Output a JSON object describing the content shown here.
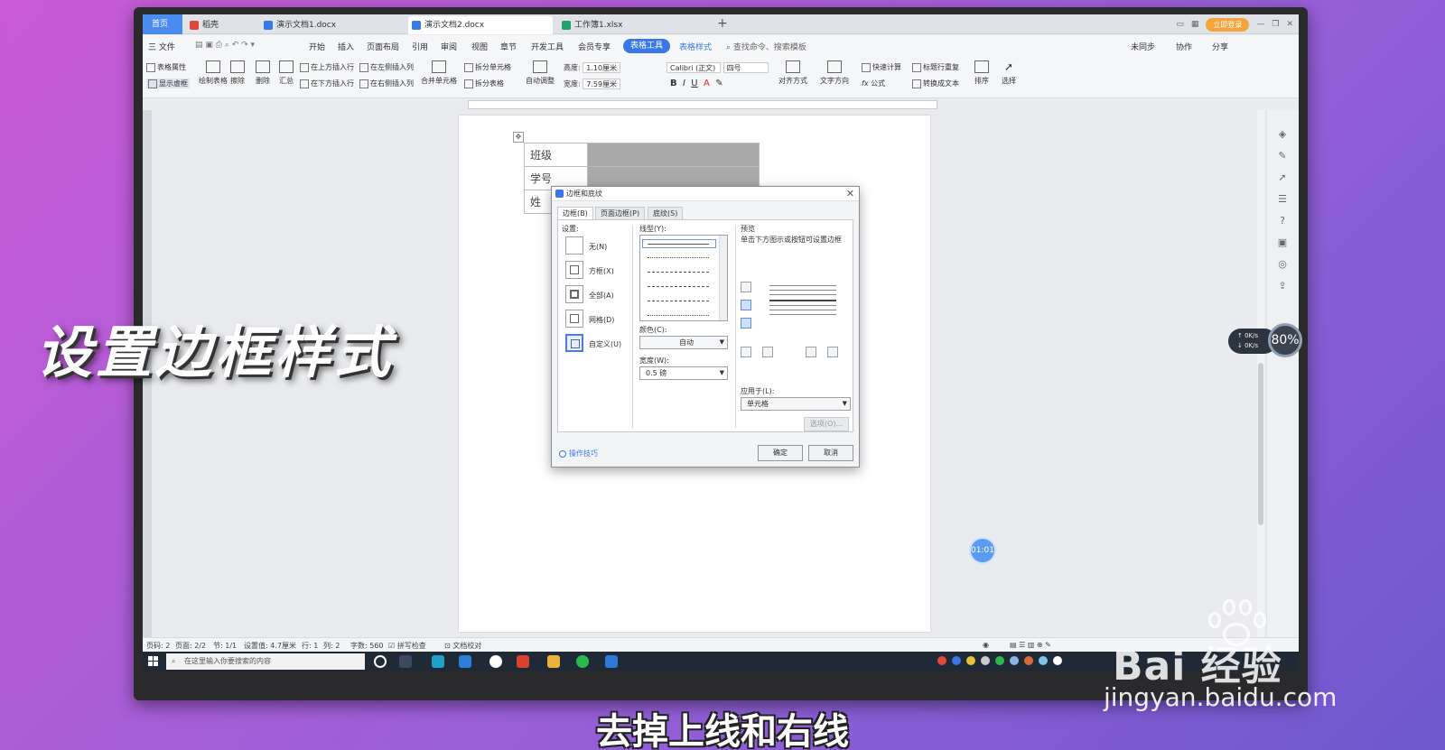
{
  "tabs": {
    "home": "首页",
    "t1": "稻壳",
    "t2": "演示文档1.docx",
    "t3": "演示文档2.docx",
    "t4": "工作簿1.xlsx",
    "plus": "+"
  },
  "topright": {
    "login": "立即登录"
  },
  "menu": {
    "file": "三 文件",
    "items": [
      "开始",
      "插入",
      "页面布局",
      "引用",
      "审阅",
      "视图",
      "章节",
      "开发工具",
      "会员专享"
    ],
    "table_tools": "表格工具",
    "table_style": "表格样式",
    "search": "查找命令、搜索模板",
    "sync": "未同步",
    "collab": "协作",
    "share": "分享"
  },
  "ribbon": {
    "table_props": "表格属性",
    "show_grid": "显示虚框",
    "draw_table": "绘制表格",
    "erase": "擦除",
    "delete": "删除",
    "summary": "汇总",
    "insert_above": "在上方插入行",
    "insert_below": "在下方插入行",
    "insert_left": "在左侧插入列",
    "insert_right": "在右侧插入列",
    "merge": "合并单元格",
    "split_cell": "拆分单元格",
    "split_table": "拆分表格",
    "autofit": "自动调整",
    "height_label": "高度:",
    "height_value": "1.10厘米",
    "width_label": "宽度:",
    "width_value": "7.59厘米",
    "font_name": "Calibri (正文)",
    "font_size": "四号",
    "align": "对齐方式",
    "text_dir": "文字方向",
    "quick_calc": "快速计算",
    "repeat_title": "标题行重复",
    "formula": "公式",
    "to_text": "转换成文本",
    "sort": "排序",
    "select": "选择"
  },
  "doc_table": {
    "rows": [
      "班级",
      "学号",
      "姓"
    ]
  },
  "dialog": {
    "title": "边框和底纹",
    "tabs": [
      "边框(B)",
      "页面边框(P)",
      "底纹(S)"
    ],
    "settings_label": "设置:",
    "settings": [
      "无(N)",
      "方框(X)",
      "全部(A)",
      "网格(D)",
      "自定义(U)"
    ],
    "linetype_label": "线型(Y):",
    "color_label": "颜色(C):",
    "color_value": "自动",
    "width_label": "宽度(W):",
    "width_value": "0.5  磅",
    "preview_label": "预览",
    "preview_hint": "单击下方图示或按钮可设置边框",
    "apply_label": "应用于(L):",
    "apply_value": "单元格",
    "options_btn": "选项(O)...",
    "tips": "操作技巧",
    "ok": "确定",
    "cancel": "取消"
  },
  "status": {
    "page": "页码: 2",
    "pages": "页面: 2/2",
    "section": "节: 1/1",
    "setting": "设置值: 4.7厘米",
    "row": "行: 1",
    "col": "列: 2",
    "words": "字数: 560",
    "spell": "拼写检查",
    "proof": "文档校对"
  },
  "taskbar": {
    "search_placeholder": "在这里输入你要搜索的内容"
  },
  "net": {
    "up": "0K/s",
    "down": "0K/s",
    "percent": "80%"
  },
  "timer": "01:01",
  "overlay": {
    "title": "设置边框样式",
    "subtitle": "去掉上线和右线"
  },
  "watermark": {
    "brand": "Bai 经验",
    "url": "jingyan.baidu.com"
  }
}
